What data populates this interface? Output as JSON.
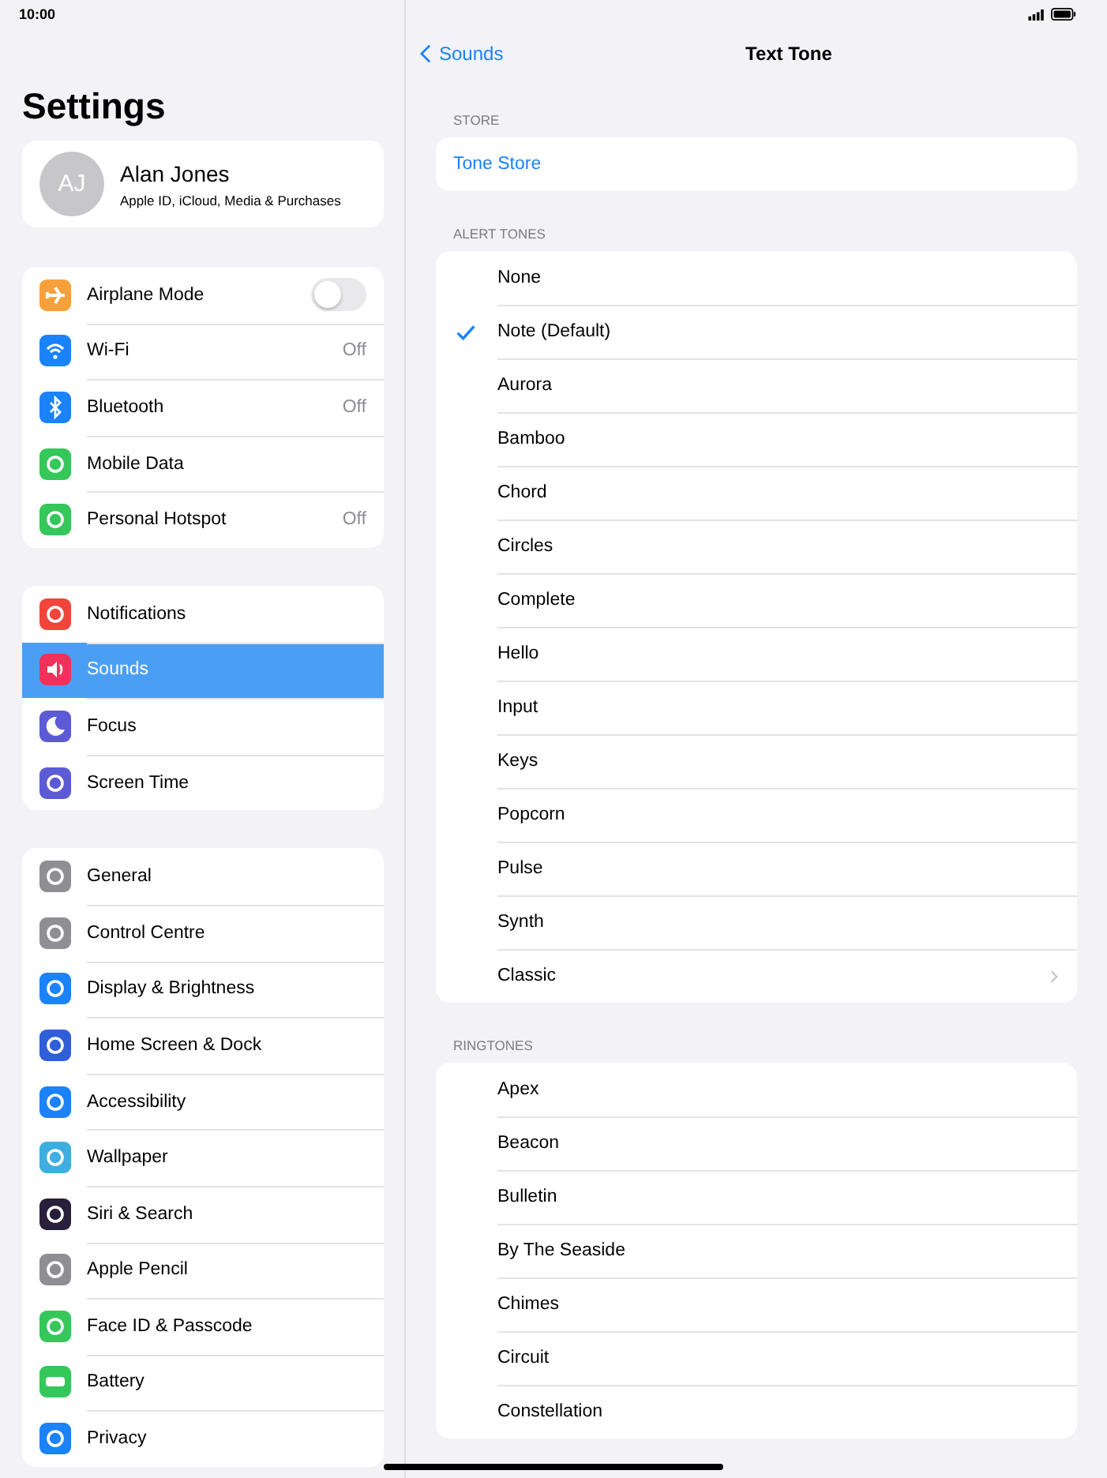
{
  "status_bar": {
    "time": "10:00"
  },
  "sidebar": {
    "title": "Settings",
    "account": {
      "initials": "AJ",
      "name": "Alan Jones",
      "subtitle": "Apple ID, iCloud, Media & Purchases"
    },
    "groups": [
      [
        {
          "label": "Airplane Mode",
          "kind": "toggle",
          "on": false,
          "selected": false
        },
        {
          "label": "Wi-Fi",
          "kind": "value",
          "value": "Off",
          "selected": false
        },
        {
          "label": "Bluetooth",
          "kind": "value",
          "value": "Off",
          "selected": false
        },
        {
          "label": "Mobile Data",
          "kind": "plain",
          "selected": false
        },
        {
          "label": "Personal Hotspot",
          "kind": "value",
          "value": "Off",
          "selected": false
        }
      ],
      [
        {
          "label": "Notifications",
          "kind": "plain",
          "selected": false
        },
        {
          "label": "Sounds",
          "kind": "plain",
          "selected": true
        },
        {
          "label": "Focus",
          "kind": "plain",
          "selected": false
        },
        {
          "label": "Screen Time",
          "kind": "plain",
          "selected": false
        }
      ],
      [
        {
          "label": "General",
          "kind": "plain",
          "selected": false
        },
        {
          "label": "Control Centre",
          "kind": "plain",
          "selected": false
        },
        {
          "label": "Display & Brightness",
          "kind": "plain",
          "selected": false
        },
        {
          "label": "Home Screen & Dock",
          "kind": "plain",
          "selected": false
        },
        {
          "label": "Accessibility",
          "kind": "plain",
          "selected": false
        },
        {
          "label": "Wallpaper",
          "kind": "plain",
          "selected": false
        },
        {
          "label": "Siri & Search",
          "kind": "plain",
          "selected": false
        },
        {
          "label": "Apple Pencil",
          "kind": "plain",
          "selected": false
        },
        {
          "label": "Face ID & Passcode",
          "kind": "plain",
          "selected": false
        },
        {
          "label": "Battery",
          "kind": "plain",
          "selected": false
        },
        {
          "label": "Privacy",
          "kind": "plain",
          "selected": false
        }
      ]
    ]
  },
  "detail": {
    "back": "Sounds",
    "title": "Text Tone",
    "sections": [
      {
        "header": "STORE",
        "items": [
          {
            "label": "Tone Store",
            "kind": "link"
          }
        ]
      },
      {
        "header": "ALERT TONES",
        "items": [
          {
            "label": "None",
            "kind": "option",
            "checked": false
          },
          {
            "label": "Note (Default)",
            "kind": "option",
            "checked": true
          },
          {
            "label": "Aurora",
            "kind": "option",
            "checked": false
          },
          {
            "label": "Bamboo",
            "kind": "option",
            "checked": false
          },
          {
            "label": "Chord",
            "kind": "option",
            "checked": false
          },
          {
            "label": "Circles",
            "kind": "option",
            "checked": false
          },
          {
            "label": "Complete",
            "kind": "option",
            "checked": false
          },
          {
            "label": "Hello",
            "kind": "option",
            "checked": false
          },
          {
            "label": "Input",
            "kind": "option",
            "checked": false
          },
          {
            "label": "Keys",
            "kind": "option",
            "checked": false
          },
          {
            "label": "Popcorn",
            "kind": "option",
            "checked": false
          },
          {
            "label": "Pulse",
            "kind": "option",
            "checked": false
          },
          {
            "label": "Synth",
            "kind": "option",
            "checked": false
          },
          {
            "label": "Classic",
            "kind": "submenu"
          }
        ]
      },
      {
        "header": "RINGTONES",
        "items": [
          {
            "label": "Apex",
            "kind": "option",
            "checked": false
          },
          {
            "label": "Beacon",
            "kind": "option",
            "checked": false
          },
          {
            "label": "Bulletin",
            "kind": "option",
            "checked": false
          },
          {
            "label": "By The Seaside",
            "kind": "option",
            "checked": false
          },
          {
            "label": "Chimes",
            "kind": "option",
            "checked": false
          },
          {
            "label": "Circuit",
            "kind": "option",
            "checked": false
          },
          {
            "label": "Constellation",
            "kind": "option",
            "checked": false
          }
        ]
      }
    ]
  }
}
